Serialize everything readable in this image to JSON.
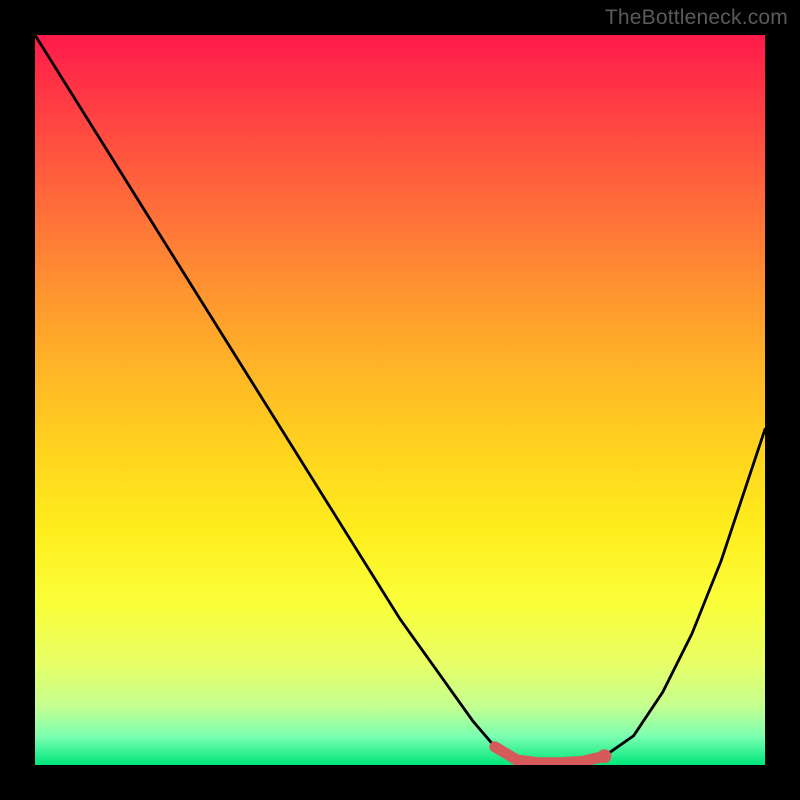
{
  "watermark": "TheBottleneck.com",
  "colors": {
    "curve_stroke": "#000000",
    "highlight_stroke": "#d65a5a",
    "highlight_fill": "#d65a5a",
    "frame": "#000000"
  },
  "chart_data": {
    "type": "line",
    "title": "",
    "xlabel": "",
    "ylabel": "",
    "xlim": [
      0,
      100
    ],
    "ylim": [
      0,
      100
    ],
    "grid": false,
    "series": [
      {
        "name": "bottleneck-curve",
        "x": [
          0,
          5,
          10,
          15,
          20,
          25,
          30,
          35,
          40,
          45,
          50,
          55,
          60,
          63,
          66,
          69,
          72,
          75,
          78,
          82,
          86,
          90,
          94,
          100
        ],
        "y": [
          100,
          92,
          84,
          76,
          68,
          60,
          52,
          44,
          36,
          28,
          20,
          13,
          6,
          2.5,
          0.7,
          0.3,
          0.3,
          0.5,
          1.2,
          4,
          10,
          18,
          28,
          46
        ]
      }
    ],
    "highlight_segment": {
      "x": [
        63,
        66,
        69,
        72,
        75,
        78
      ],
      "y": [
        2.5,
        0.7,
        0.3,
        0.3,
        0.5,
        1.2
      ]
    },
    "highlight_marker": {
      "x": 78,
      "y": 1.2
    }
  }
}
